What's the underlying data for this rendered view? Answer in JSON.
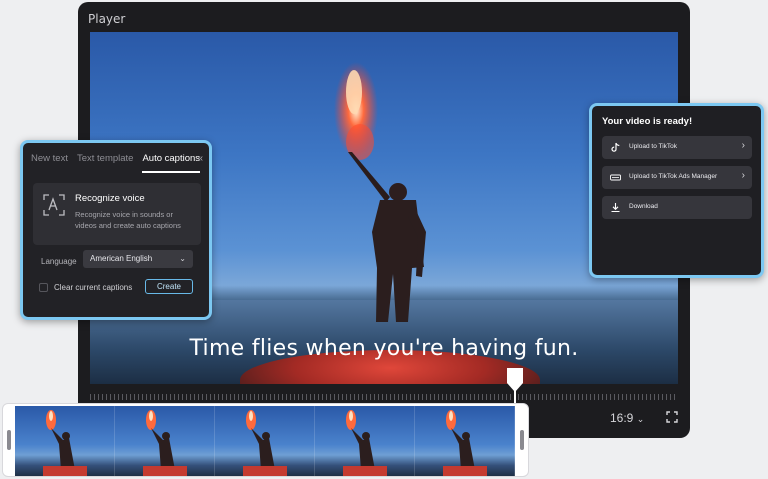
{
  "player": {
    "title": "Player",
    "caption_text": "Time flies when you're having fun.",
    "aspect_ratio": "16:9",
    "aspect_icon": "chevron-down-icon",
    "fullscreen_icon": "fullscreen-icon"
  },
  "caption_panel": {
    "tabs": [
      {
        "label": "New text"
      },
      {
        "label": "Text template"
      },
      {
        "label": "Auto captions"
      }
    ],
    "collapse_icon": "«",
    "recognize": {
      "title": "Recognize voice",
      "description": "Recognize voice in sounds or videos and create auto captions"
    },
    "language_label": "Language",
    "language_value": "American English",
    "clear_label": "Clear current captions",
    "create_label": "Create"
  },
  "ready_panel": {
    "title": "Your video is ready!",
    "items": [
      {
        "label": "Upload to TikTok",
        "icon": "tiktok-icon"
      },
      {
        "label": "Upload to TikTok Ads Manager",
        "icon": "tiktok-ads-icon"
      },
      {
        "label": "Download",
        "icon": "download-icon"
      }
    ]
  },
  "colors": {
    "accent_border": "#7cc8f2",
    "panel_bg": "#222226",
    "flare": "#ff4a2e"
  }
}
